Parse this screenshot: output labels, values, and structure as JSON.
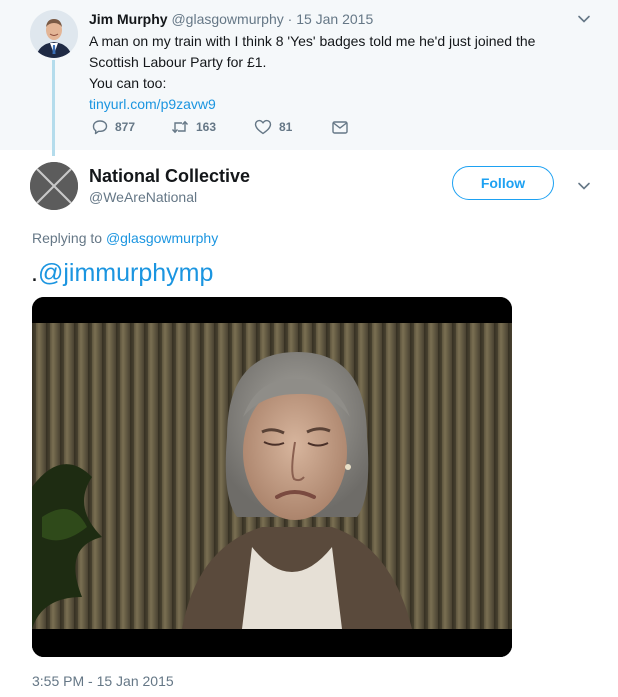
{
  "parent_tweet": {
    "author_name": "Jim Murphy",
    "author_handle": "@glasgowmurphy",
    "separator": "·",
    "date": "15 Jan 2015",
    "text_line1": "A man on my train with I think 8 'Yes' badges told me he'd just joined the",
    "text_line2": "Scottish Labour Party for £1.",
    "text_line3": "You can too:",
    "link": "tinyurl.com/p9zavw9",
    "replies": "877",
    "retweets": "163",
    "likes": "81"
  },
  "main_tweet": {
    "author_name": "National Collective",
    "author_handle": "@WeAreNational",
    "follow_label": "Follow",
    "replying_prefix": "Replying to",
    "replying_handle": "@glasgowmurphy",
    "text_prefix": ".",
    "text_mention": "@jimmurphymp",
    "timestamp": "3:55 PM - 15 Jan 2015"
  },
  "colors": {
    "link": "#1b95e0",
    "follow_accent": "#1da1f2",
    "muted": "#657786",
    "parent_bg": "#f5f8fa",
    "thread_line": "#b4dcec"
  },
  "icons": [
    "reply-icon",
    "retweet-icon",
    "like-icon",
    "message-icon",
    "chevron-down-icon"
  ]
}
